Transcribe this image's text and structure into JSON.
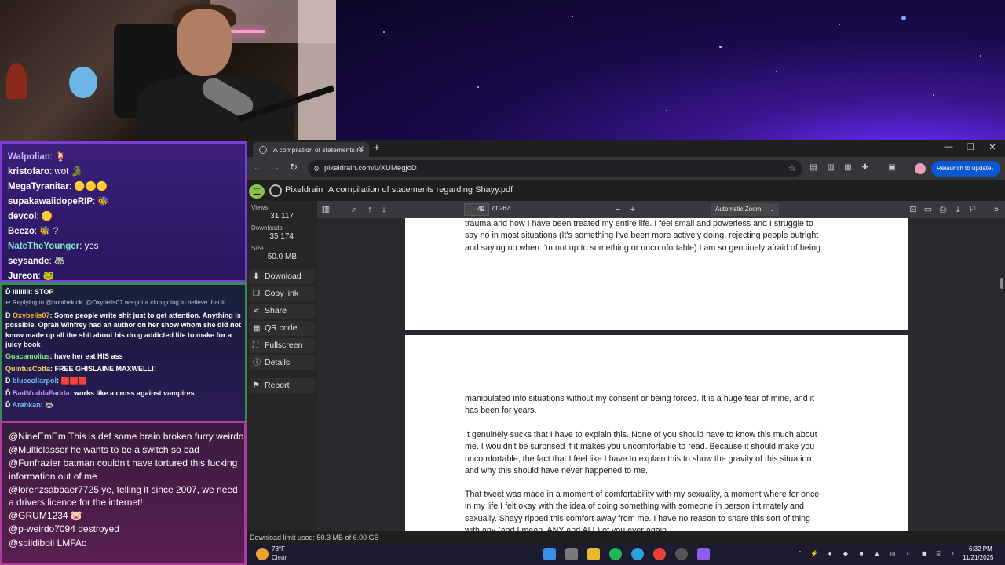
{
  "chat_top": [
    {
      "user": "Walpolian",
      "color": "#c9b7ff",
      "msg": "🍹"
    },
    {
      "user": "kristofaro",
      "color": "#ffffff",
      "msg": "wot 🐊"
    },
    {
      "user": "MegaTyranitar",
      "color": "#ffffff",
      "msg": "🟡🟡🟡"
    },
    {
      "user": "supakawaiidopeRIP",
      "color": "#ffffff",
      "msg": "🐝"
    },
    {
      "user": "devcol",
      "color": "#ffffff",
      "msg": "🟡"
    },
    {
      "user": "Beezo",
      "color": "#ffffff",
      "msg": "🐝 ?"
    },
    {
      "user": "NateTheYounger",
      "color": "#7ef0c9",
      "msg": "yes"
    },
    {
      "user": "seysande",
      "color": "#ffffff",
      "msg": "🦝"
    },
    {
      "user": "Jureon",
      "color": "#ffffff",
      "msg": "🐸"
    }
  ],
  "chat_mid": [
    {
      "type": "msg",
      "user": "lllllllll",
      "color": "#ffffff",
      "msg": "STOP"
    },
    {
      "type": "reply",
      "text": "↩ Replying to @bobthekick: @Oxybelis07 we got a club going to believe that it"
    },
    {
      "type": "msg",
      "user": "Oxybelis07",
      "color": "#ffb347",
      "msg": "Some people write shit just to get attention. Anything is possible. Oprah Winfrey had an author on her show whom she did not know made up all the shit about his drug addicted life to make for a juicy book"
    },
    {
      "type": "msg",
      "user": "Guacamolius",
      "color": "#7ef07e",
      "msg": "have her eat HIS ass"
    },
    {
      "type": "msg",
      "user": "QuintusCotta",
      "color": "#ffd36e",
      "msg": "FREE GHISLAINE MAXWELL!!"
    },
    {
      "type": "msg",
      "user": "bluecollarpol",
      "color": "#6fb8ff",
      "msg": "🟥🟥🟥"
    },
    {
      "type": "msg",
      "user": "BadMuddaFadda",
      "color": "#c88cff",
      "msg": "works like a cross against vampires"
    },
    {
      "type": "msg",
      "user": "Arahkan",
      "color": "#6fb8ff",
      "msg": "🦝"
    }
  ],
  "chat_bottom": [
    {
      "user": "@NineEmEm",
      "msg": "This is def some brain broken furry weirdo"
    },
    {
      "user": "@Multiclasser",
      "msg": "he wants to be a switch so bad"
    },
    {
      "user": "@Funfrazier",
      "msg": "batman couldn't have tortured this fucking information out of me"
    },
    {
      "user": "@lorenzsabbaer7725",
      "msg": "ye, telling it since 2007, we need a drivers licence for the internet!"
    },
    {
      "user": "@GRUM1234",
      "msg": "🐷"
    },
    {
      "user": "@p-weirdo7094",
      "msg": "destroyed"
    },
    {
      "user": "@spiidiboii",
      "msg": "LMFAo"
    }
  ],
  "browser": {
    "tab_title": "A compilation of statements re",
    "url": "pixeldrain.com/u/XUMegjoD",
    "relaunch": "Relaunch to update"
  },
  "pixeldrain": {
    "brand": "Pixeldrain",
    "file_title": "A compilation of statements regarding Shayy.pdf",
    "views_label": "Views",
    "views": "31 117",
    "downloads_label": "Downloads",
    "downloads": "35 174",
    "size_label": "Size",
    "size": "50.0 MB",
    "buttons": {
      "download": "Download",
      "copy_link": "Copy link",
      "share": "Share",
      "qr_code": "QR code",
      "fullscreen": "Fullscreen",
      "details": "Details",
      "report": "Report"
    },
    "download_limit": "Download limit used: 50.3 MB of 6.00 GB"
  },
  "pdf": {
    "page_number": "49",
    "page_count": "of 262",
    "zoom": "Automatic Zoom",
    "page1_lines": [
      "trauma and how I have been treated my entire life. I feel small and powerless and I struggle to",
      "say no in most situations (It's something I've been more actively doing, rejecting people outright",
      "and saying no when I'm not up to something or uncomfortable) I am so genuinely afraid of being"
    ],
    "page2_para1": [
      "manipulated into situations without my consent or being forced. It is a huge fear of mine, and it",
      "has been for years."
    ],
    "page2_para2": [
      "It genuinely sucks that I have to explain this. None of you should have to know this much about",
      "me. I wouldn't be surprised if it makes you uncomfortable to read. Because it should make you",
      "uncomfortable, the fact that I feel like I have to explain this to show the gravity of this situation",
      "and why this should have never happened to me."
    ],
    "page2_para3": [
      "That tweet was made in a moment of comfortability with my sexuality, a moment where for once",
      "in my life I felt okay with the idea of doing something with someone in person intimately and",
      "sexually. Shayy ripped this comfort away from me. I have no reason to share this sort of thing",
      "with any (and I mean, ANY and ALL) of you ever again."
    ]
  },
  "taskbar": {
    "temp": "78°F",
    "condition": "Clear",
    "time": "6:32 PM",
    "date": "11/21/2025"
  }
}
